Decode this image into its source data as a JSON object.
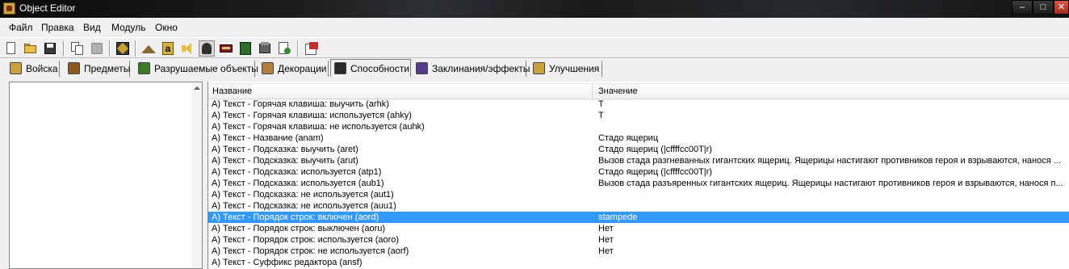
{
  "window": {
    "title": "Object Editor",
    "controls": {
      "minimize": "–",
      "maximize": "□",
      "close": "✕"
    }
  },
  "menu": [
    "Файл",
    "Правка",
    "Вид",
    "Модуль",
    "Окно"
  ],
  "toolbar": {
    "buttons": [
      {
        "name": "new-file-icon",
        "color": "#ffffff"
      },
      {
        "name": "open-folder-icon",
        "color": "#e8c04a"
      },
      {
        "name": "save-icon",
        "color": "#3a3a3a"
      },
      {
        "name": "copy-icon",
        "color": "#ffffff"
      },
      {
        "name": "paste-icon",
        "color": "#b0b0b0"
      },
      {
        "name": "terrain-editor-icon",
        "color": "#c8a030"
      },
      {
        "name": "triggers-icon",
        "color": "#8a6a30"
      },
      {
        "name": "text-editor-icon",
        "color": "#d8b040"
      },
      {
        "name": "sound-editor-icon",
        "color": "#e0c040"
      },
      {
        "name": "object-editor-icon",
        "color": "#303030"
      },
      {
        "name": "campaign-editor-icon",
        "color": "#7a2020"
      },
      {
        "name": "ai-editor-icon",
        "color": "#2e6a2e"
      },
      {
        "name": "import-manager-icon",
        "color": "#606060"
      },
      {
        "name": "test-map-icon",
        "color": "#3a8a3a"
      },
      {
        "name": "export-icon",
        "color": "#c03030"
      }
    ]
  },
  "tabs": [
    {
      "label": "Войска",
      "icon": "units-icon",
      "color": "#c8a040"
    },
    {
      "label": "Предметы",
      "icon": "items-icon",
      "color": "#8a5a20"
    },
    {
      "label": "Разрушаемые объекты",
      "icon": "destructibles-icon",
      "color": "#3a7a2a"
    },
    {
      "label": "Декорации",
      "icon": "doodads-icon",
      "color": "#b08040"
    },
    {
      "label": "Способности",
      "icon": "abilities-icon",
      "color": "#2a2a2a"
    },
    {
      "label": "Заклинания/эффекты",
      "icon": "buffs-icon",
      "color": "#5a3a8a"
    },
    {
      "label": "Улучшения",
      "icon": "upgrades-icon",
      "color": "#c8a040"
    }
  ],
  "active_tab": "Способности",
  "grid": {
    "columns": [
      "Название",
      "Значение"
    ],
    "rows": [
      {
        "name": "А) Текст - Горячая клавиша: выучить (arhk)",
        "value": "T"
      },
      {
        "name": "А) Текст - Горячая клавиша: используется (ahky)",
        "value": "T"
      },
      {
        "name": "А) Текст - Горячая клавиша: не используется (auhk)",
        "value": ""
      },
      {
        "name": "А) Текст - Название (anam)",
        "value": "Стадо ящериц"
      },
      {
        "name": "А) Текст - Подсказка: выучить (aret)",
        "value": "Стадо ящериц (|cffffcc00T|r)"
      },
      {
        "name": "А) Текст - Подсказка: выучить (arut)",
        "value": "Вызов стада разгневанных гигантских ящериц. Ящерицы настигают противников героя и взрываются, нанося ..."
      },
      {
        "name": "А) Текст - Подсказка: используется (atp1)",
        "value": "Стадо ящериц (|cffffcc00T|r)"
      },
      {
        "name": "А) Текст - Подсказка: используется (aub1)",
        "value": "Вызов стада разъяренных гигантских ящериц. Ящерицы настигают противников героя и взрываются, нанося п..."
      },
      {
        "name": "А) Текст - Подсказка: не используется (aut1)",
        "value": ""
      },
      {
        "name": "А) Текст - Подсказка: не используется (auu1)",
        "value": ""
      },
      {
        "name": "А) Текст - Порядок строк: включен (aord)",
        "value": "stampede",
        "selected": true
      },
      {
        "name": "А) Текст - Порядок строк: выключен (aoru)",
        "value": "Нет"
      },
      {
        "name": "А) Текст - Порядок строк: используется (aoro)",
        "value": "Нет"
      },
      {
        "name": "А) Текст - Порядок строк: не используется (aorf)",
        "value": "Нет"
      },
      {
        "name": "А) Текст - Суффикс редактора (ansf)",
        "value": ""
      }
    ]
  },
  "colors": {
    "selection": "#3399ff",
    "window_bg": "#f0f0f0"
  }
}
